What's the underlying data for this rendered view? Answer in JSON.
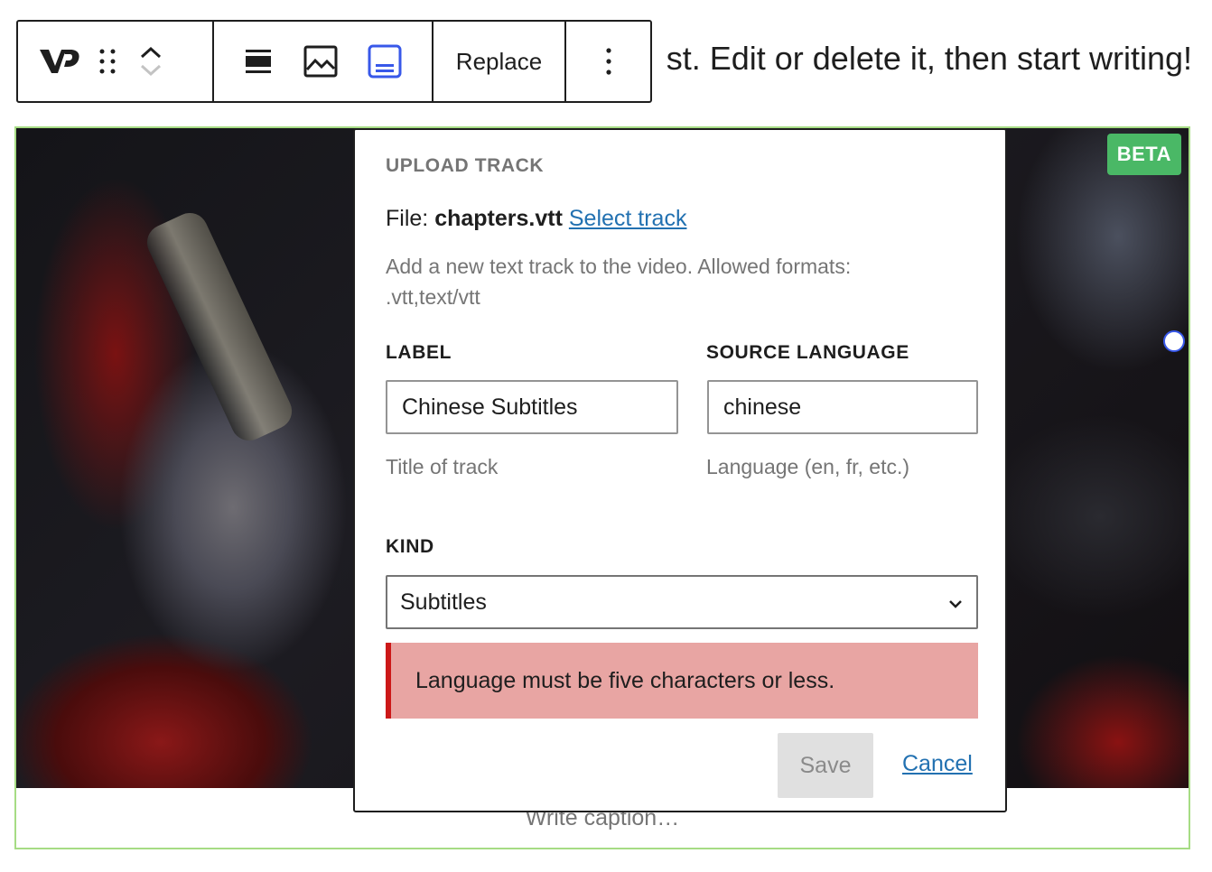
{
  "intro": {
    "text": "st. Edit or delete it, then start writing!"
  },
  "toolbar": {
    "replace_label": "Replace",
    "icons": [
      "videopress-logo-icon",
      "drag-handle-icon",
      "move-up-icon",
      "move-down-icon",
      "align-none-icon",
      "poster-image-icon",
      "tracks-icon",
      "more-options-icon"
    ]
  },
  "video": {
    "beta_badge": "BETA",
    "caption_placeholder": "Write caption…"
  },
  "upload_track": {
    "title": "UPLOAD TRACK",
    "file_prefix": "File:",
    "file_name": "chapters.vtt",
    "select_track": "Select track",
    "help": "Add a new text track to the video. Allowed formats: .vtt,text/vtt",
    "label": {
      "heading": "LABEL",
      "value": "Chinese Subtitles",
      "help": "Title of track"
    },
    "source_language": {
      "heading": "SOURCE LANGUAGE",
      "value": "chinese",
      "help": "Language (en, fr, etc.)"
    },
    "kind": {
      "heading": "KIND",
      "selected": "Subtitles"
    },
    "error": "Language must be five characters or less.",
    "save": "Save",
    "cancel": "Cancel"
  },
  "colors": {
    "accent_blue": "#3858e9",
    "link_blue": "#2271b1",
    "beta_green": "#4ab866",
    "error_bg": "#e8a5a3",
    "error_border": "#cc1818",
    "block_border": "#a6dc84"
  }
}
